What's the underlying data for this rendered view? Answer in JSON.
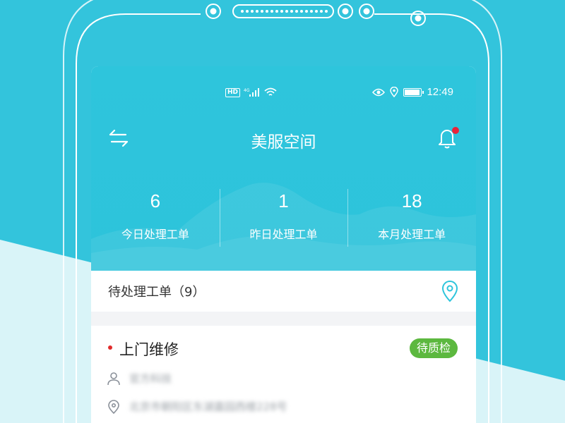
{
  "status_bar": {
    "hd_badge": "HD",
    "network_text": "4G",
    "time": "12:49",
    "battery_level": 0.85
  },
  "nav": {
    "title": "美服空间",
    "icons": {
      "left": "switch-arrows-icon",
      "right": "bell-icon",
      "notification_dot": true
    }
  },
  "stats": [
    {
      "value": "6",
      "label": "今日处理工单"
    },
    {
      "value": "1",
      "label": "昨日处理工单"
    },
    {
      "value": "18",
      "label": "本月处理工单"
    }
  ],
  "pending": {
    "title": "待处理工单（9）",
    "icon": "location-pin-icon"
  },
  "work_order": {
    "title": "上门维修",
    "status": "待质检",
    "contact_name": "官方科技",
    "address": "北京市朝阳区东湖嘉园西楼228号"
  },
  "colors": {
    "background": "#33c4dc",
    "header": "#2ec5dc",
    "status_badge": "#5cb83f",
    "notification_dot": "#e8233a",
    "title_dot": "#e12b2b",
    "icon_accent": "#2ec5dc"
  }
}
